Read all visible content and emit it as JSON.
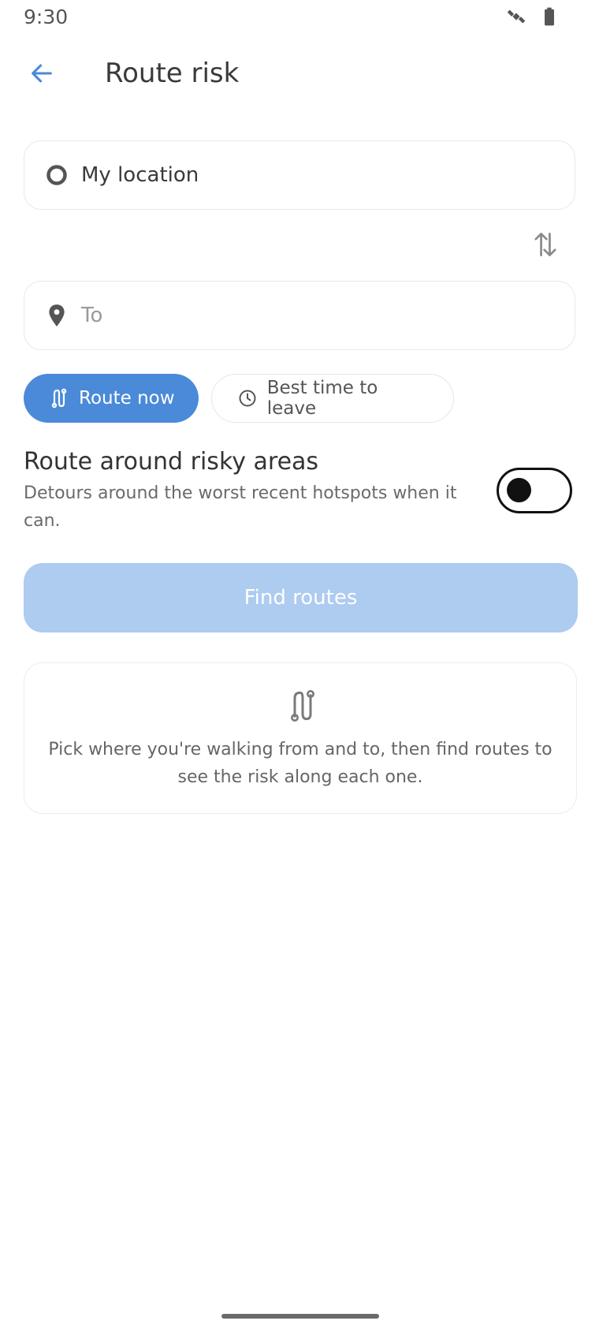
{
  "status_bar": {
    "time": "9:30",
    "icons": [
      "satellite-icon",
      "battery-icon"
    ]
  },
  "app_bar": {
    "back_icon": "arrow-left-icon",
    "title": "Route risk"
  },
  "from_field": {
    "icon": "circle-outline-icon",
    "value": "My location"
  },
  "swap_icon": "swap-vertical-icon",
  "to_field": {
    "icon": "location-pin-icon",
    "placeholder": "To",
    "value": ""
  },
  "chips": [
    {
      "label": "Route now",
      "icon": "route-icon",
      "selected": true
    },
    {
      "label": "Best time to leave",
      "icon": "clock-icon",
      "selected": false
    }
  ],
  "risk_toggle": {
    "title": "Route around risky areas",
    "description": "Detours around the worst recent hotspots when it can.",
    "enabled": false
  },
  "find_button": {
    "label": "Find routes",
    "enabled": false
  },
  "empty_state": {
    "icon": "route-icon",
    "message": "Pick where you're walking from and to, then find routes to see the risk along each one."
  },
  "colors": {
    "accent": "#4a8ad8",
    "accent_disabled": "#aecbf0",
    "text_primary": "#333333",
    "text_secondary": "#6a6a6a"
  }
}
